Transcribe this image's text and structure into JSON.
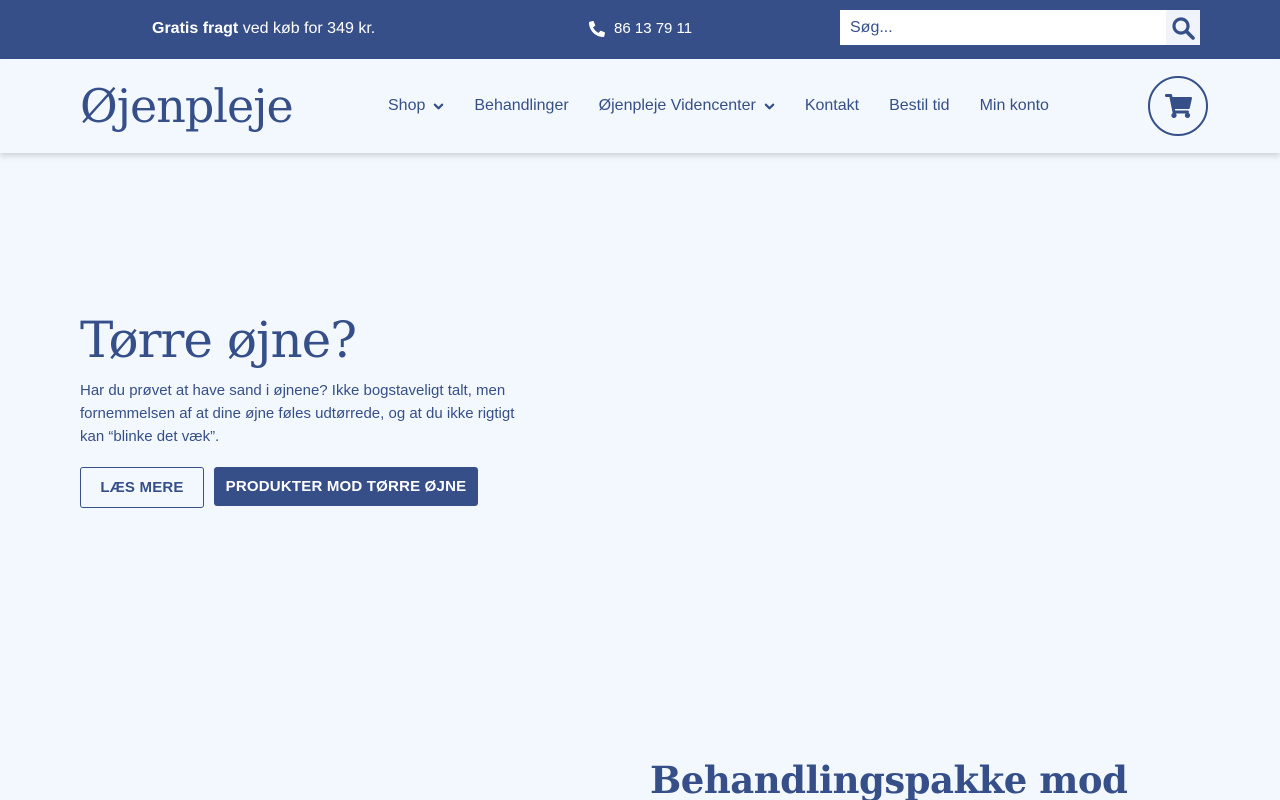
{
  "topbar": {
    "shipping_bold": "Gratis fragt",
    "shipping_rest": " ved køb for 349 kr.",
    "phone": "86 13 79 11",
    "search_placeholder": "Søg..."
  },
  "header": {
    "logo": "Øjenpleje",
    "nav": [
      {
        "label": "Shop",
        "has_dropdown": true
      },
      {
        "label": "Behandlinger",
        "has_dropdown": false
      },
      {
        "label": "Øjenpleje Videncenter",
        "has_dropdown": true
      },
      {
        "label": "Kontakt",
        "has_dropdown": false
      },
      {
        "label": "Bestil tid",
        "has_dropdown": false
      },
      {
        "label": "Min konto",
        "has_dropdown": false
      }
    ]
  },
  "hero": {
    "title": "Tørre øjne?",
    "text": "Har du prøvet at have sand i øjnene? Ikke bogstaveligt talt, men fornemmelsen af at dine øjne føles udtørrede, og at du ikke rigtigt kan “blinke det væk”.",
    "btn_more": "LÆS MERE",
    "btn_products": "PRODUKTER MOD TØRRE ØJNE"
  },
  "section": {
    "title": "Behandlingspakke mod"
  },
  "colors": {
    "brand": "#364f89",
    "background": "#f2f8fd",
    "topbar_text": "#ffffff"
  }
}
